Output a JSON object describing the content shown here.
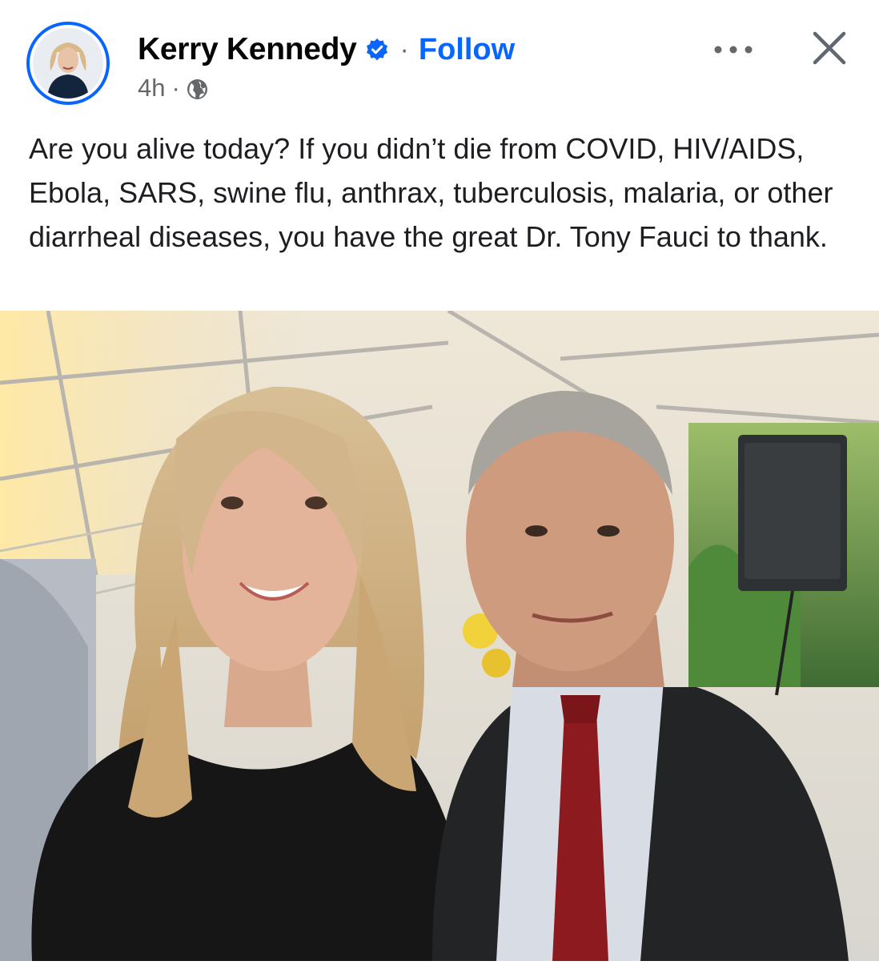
{
  "post": {
    "author": {
      "name": "Kerry Kennedy",
      "verified_icon": "verified-badge-icon"
    },
    "separator": "·",
    "follow_label": "Follow",
    "timestamp": "4h",
    "meta_separator": "·",
    "audience_icon": "globe-icon",
    "more_icon": "more-options-icon",
    "close_icon": "close-icon",
    "text": "Are you alive today? If you didn’t die from COVID, HIV/AIDS, Ebola, SARS, swine flu, anthrax, tuberculosis, malaria, or other diarrheal diseases, you have the great Dr. Tony Fauci to thank."
  },
  "colors": {
    "accent": "#0866ff",
    "secondary_text": "#65676b",
    "primary_text": "#050505"
  }
}
